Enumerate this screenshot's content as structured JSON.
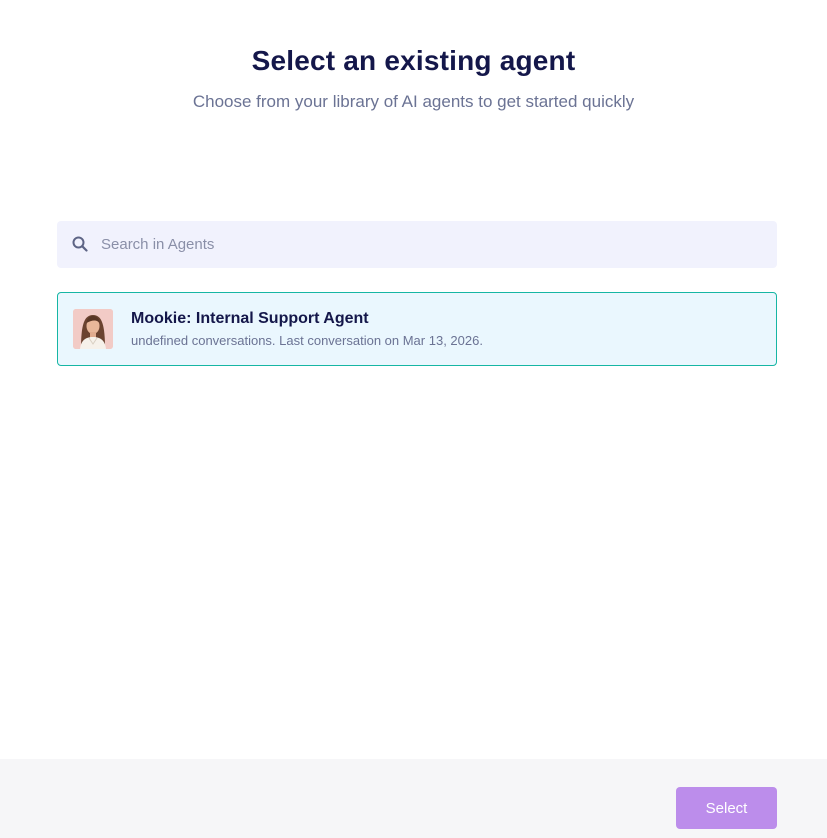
{
  "header": {
    "title": "Select an existing agent",
    "subtitle": "Choose from your library of AI agents to get started quickly"
  },
  "search": {
    "placeholder": "Search in Agents",
    "value": "",
    "icon": "search-icon"
  },
  "agents": [
    {
      "name": "Mookie: Internal Support Agent",
      "meta": "undefined conversations. Last conversation on Mar 13, 2026.",
      "selected": true,
      "avatar": "agent-avatar"
    }
  ],
  "footer": {
    "select_label": "Select"
  },
  "colors": {
    "title": "#14174a",
    "subtitle": "#6b7394",
    "search_bg": "#f1f2fd",
    "card_bg": "#eaf7fe",
    "card_border": "#16b6a4",
    "button_bg": "#bc8deb",
    "footer_bg": "#f6f6f8"
  }
}
